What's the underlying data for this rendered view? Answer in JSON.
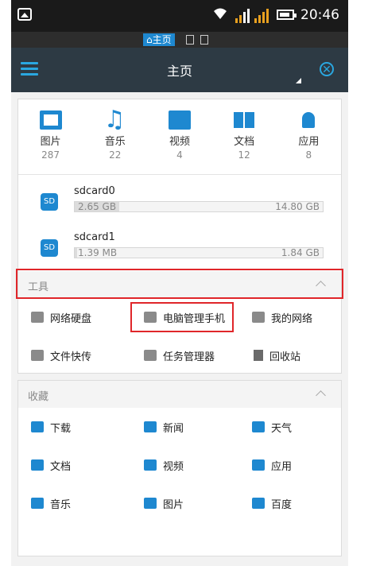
{
  "status_bar": {
    "time": "20:46",
    "notification_tag": "⌂主页"
  },
  "app_bar": {
    "title": "主页"
  },
  "categories": [
    {
      "label": "图片",
      "count": "287",
      "icon": "image-icon"
    },
    {
      "label": "音乐",
      "count": "22",
      "icon": "music-icon"
    },
    {
      "label": "视频",
      "count": "4",
      "icon": "video-icon"
    },
    {
      "label": "文档",
      "count": "12",
      "icon": "document-icon"
    },
    {
      "label": "应用",
      "count": "8",
      "icon": "android-app-icon"
    }
  ],
  "storage": [
    {
      "badge": "SD",
      "name": "sdcard0",
      "used": "2.65 GB",
      "total": "14.80 GB",
      "used_fraction": 0.18
    },
    {
      "badge": "SD",
      "name": "sdcard1",
      "used": "1.39 MB",
      "total": "1.84 GB",
      "used_fraction": 0.01
    }
  ],
  "tools": {
    "title": "工具",
    "items": [
      {
        "label": "网络硬盘",
        "icon": "network-disk-icon"
      },
      {
        "label": "电脑管理手机",
        "icon": "pc-manage-icon"
      },
      {
        "label": "我的网络",
        "icon": "my-network-icon"
      },
      {
        "label": "文件快传",
        "icon": "file-transfer-icon"
      },
      {
        "label": "任务管理器",
        "icon": "task-manager-icon"
      },
      {
        "label": "回收站",
        "icon": "trash-icon"
      }
    ]
  },
  "favorites": {
    "title": "收藏",
    "items": [
      {
        "label": "下载",
        "icon": "download-icon"
      },
      {
        "label": "新闻",
        "icon": "news-icon"
      },
      {
        "label": "天气",
        "icon": "weather-icon"
      },
      {
        "label": "文档",
        "icon": "document-icon"
      },
      {
        "label": "视频",
        "icon": "video-icon"
      },
      {
        "label": "应用",
        "icon": "app-icon"
      },
      {
        "label": "音乐",
        "icon": "music-icon"
      },
      {
        "label": "图片",
        "icon": "image-icon"
      },
      {
        "label": "百度",
        "icon": "baidu-paw-icon"
      }
    ]
  },
  "colors": {
    "accent": "#1e88d0",
    "app_bar": "#2d3a44",
    "highlight_box": "#e0262a"
  }
}
